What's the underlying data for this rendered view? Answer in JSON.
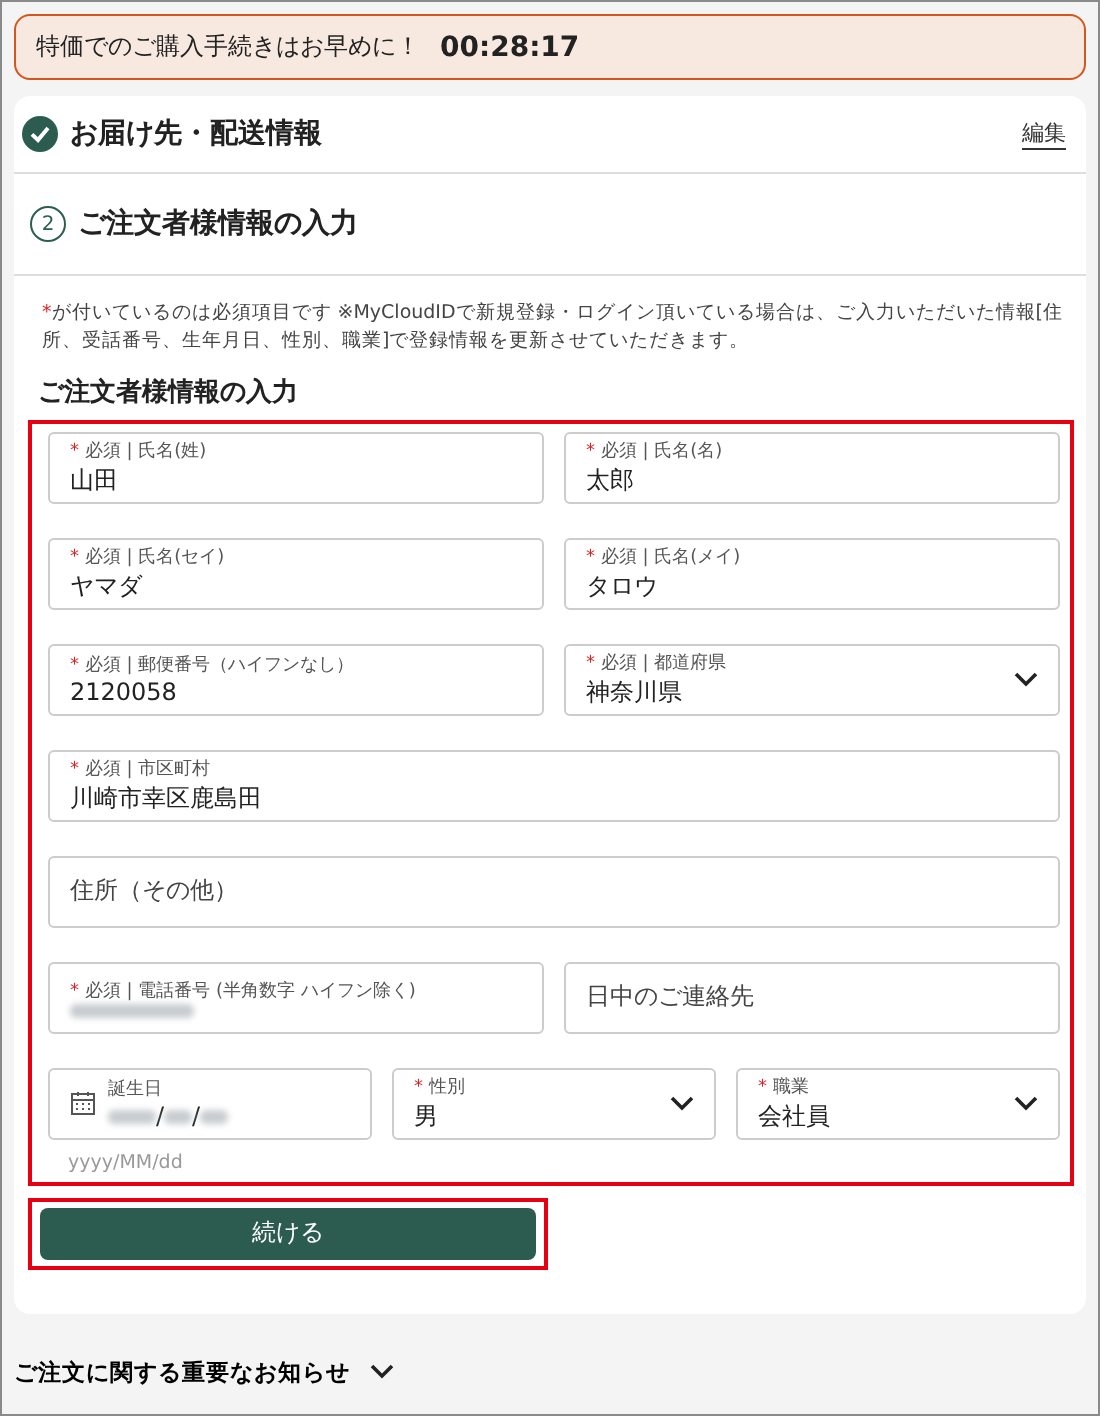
{
  "banner": {
    "text": "特価でのご購入手続きはお早めに！",
    "timer": "00:28:17"
  },
  "steps": [
    {
      "kind": "done",
      "title": "お届け先・配送情報",
      "action": "編集"
    },
    {
      "kind": "current",
      "number": "2",
      "title": "ご注文者様情報の入力"
    }
  ],
  "note": {
    "mark": "*",
    "text": "が付いているのは必須項目です ※MyCloudIDで新規登録・ログイン頂いている場合は、ご入力いただいた情報[住所、受話番号、生年月日、性別、職業]で登録情報を更新させていただきます。"
  },
  "form_title": "ご注文者様情報の入力",
  "rows": [
    [
      {
        "kind": "text",
        "mark": "*",
        "label": "必須 | 氏名(姓)",
        "value": "山田"
      },
      {
        "kind": "text",
        "mark": "*",
        "label": "必須 | 氏名(名)",
        "value": "太郎"
      }
    ],
    [
      {
        "kind": "text",
        "mark": "*",
        "label": "必須 | 氏名(セイ)",
        "value": "ヤマダ"
      },
      {
        "kind": "text",
        "mark": "*",
        "label": "必須 | 氏名(メイ)",
        "value": "タロウ"
      }
    ],
    [
      {
        "kind": "text",
        "mark": "*",
        "label": "必須 | 郵便番号（ハイフンなし）",
        "value": "2120058"
      },
      {
        "kind": "select",
        "mark": "*",
        "label": "必須 | 都道府県",
        "value": "神奈川県"
      }
    ],
    [
      {
        "kind": "text",
        "mark": "*",
        "label": "必須 | 市区町村",
        "value": "川崎市幸区鹿島田"
      }
    ],
    [
      {
        "kind": "text",
        "placeholder": "住所（その他）"
      }
    ],
    [
      {
        "kind": "redacted",
        "mark": "*",
        "label": "必須 | 電話番号 (半角数字 ハイフン除く)"
      },
      {
        "kind": "text",
        "placeholder": "日中のご連絡先"
      }
    ],
    [
      {
        "kind": "date",
        "label": "誕生日",
        "separator": "/",
        "hint": "yyyy/MM/dd"
      },
      {
        "kind": "select",
        "mark": "*",
        "label": "性別",
        "value": "男"
      },
      {
        "kind": "select",
        "mark": "*",
        "label": "職業",
        "value": "会社員"
      }
    ]
  ],
  "continue_button": "続ける",
  "footer": {
    "text": "ご注文に関する重要なお知らせ",
    "expanded": false
  }
}
